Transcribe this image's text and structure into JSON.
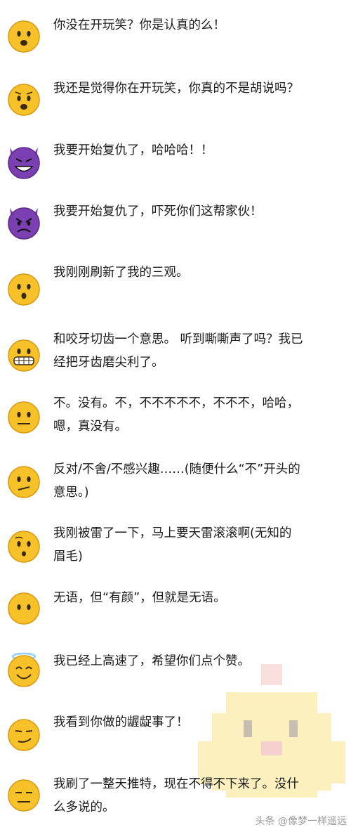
{
  "rows": [
    {
      "emoji": "frowning-open-mouth",
      "text": "你没在开玩笑？你是认真的么！"
    },
    {
      "emoji": "anguished-face",
      "text": "我还是觉得你在开玩笑，你真的不是胡说吗？"
    },
    {
      "emoji": "smiling-devil",
      "text": "我要开始复仇了，哈哈哈！！"
    },
    {
      "emoji": "angry-devil",
      "text": "我要开始复仇了，吓死你们这帮家伙！"
    },
    {
      "emoji": "hushed-face",
      "text": "我刚刚刷新了我的三观。"
    },
    {
      "emoji": "grimacing-face",
      "text": "和咬牙切齿一个意思。 听到嘶嘶声了吗？我已\n经把牙齿磨尖利了。"
    },
    {
      "emoji": "neutral-face",
      "text": "不。没有。不，不不不不不，不不不，哈哈，\n嗯，真没有。"
    },
    {
      "emoji": "confused-face",
      "text": "反对/不舍/不感兴趣……(随便什么“不”开头的\n意思。)"
    },
    {
      "emoji": "surprised-face",
      "text": "我刚被雷了一下，马上要天雷滚滚啊(无知的\n眉毛)"
    },
    {
      "emoji": "blank-face",
      "text": "无语，但“有颜”，但就是无语。"
    },
    {
      "emoji": "halo-face",
      "text": "我已经上高速了，希望你们点个赞。"
    },
    {
      "emoji": "smirking-face",
      "text": "我看到你做的龌龊事了！"
    },
    {
      "emoji": "expressionless-face",
      "text": "我刷了一整天推特，现在不得不下来了。没什\n么多说的。"
    }
  ],
  "watermark": "头条 @像梦一样遥远",
  "colors": {
    "face": "#f7c12a",
    "face_edge": "#d99a12",
    "devil": "#7a3fb0",
    "text": "#1a1a1a"
  }
}
